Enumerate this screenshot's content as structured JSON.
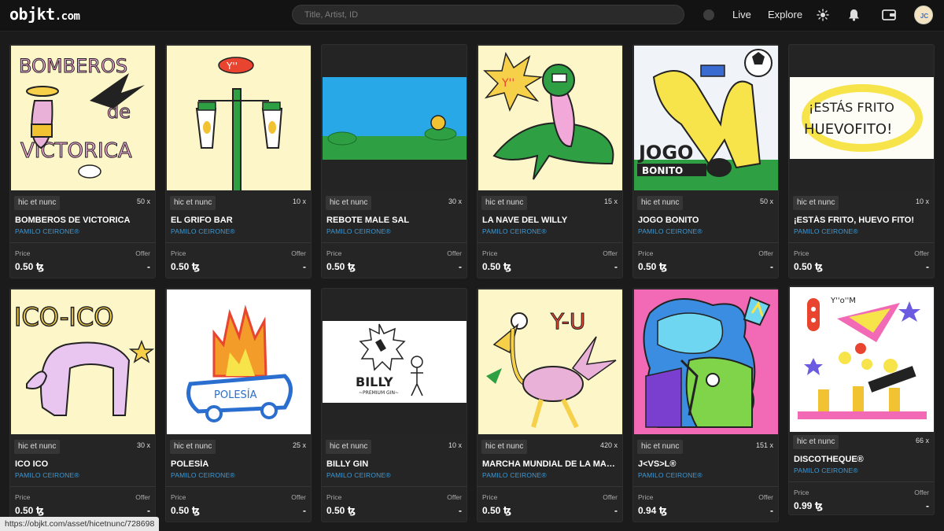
{
  "header": {
    "logo_main": "objkt",
    "logo_suffix": ".com",
    "search_placeholder": "Title, Artist, ID",
    "nav": [
      "Live",
      "Explore"
    ]
  },
  "colors": {
    "accent_artist": "#3d9ad6",
    "background": "#1b1b1b",
    "card": "#252525"
  },
  "icons": [
    "sun-icon",
    "bell-icon",
    "wallet-icon",
    "avatar"
  ],
  "price_label": "Price",
  "offer_label": "Offer",
  "cards": [
    {
      "platform": "hic et nunc",
      "editions": "50 x",
      "title": "BOMBEROS DE VICTORICA",
      "artist": "PAMILO CEIRONE®",
      "price": "0.50 ꜩ",
      "offer": "-"
    },
    {
      "platform": "hic et nunc",
      "editions": "10 x",
      "title": "EL GRIFO BAR",
      "artist": "PAMILO CEIRONE®",
      "price": "0.50 ꜩ",
      "offer": "-"
    },
    {
      "platform": "hic et nunc",
      "editions": "30 x",
      "title": "REBOTE MALE SAL",
      "artist": "PAMILO CEIRONE®",
      "price": "0.50 ꜩ",
      "offer": "-"
    },
    {
      "platform": "hic et nunc",
      "editions": "15 x",
      "title": "LA NAVE DEL WILLY",
      "artist": "PAMILO CEIRONE®",
      "price": "0.50 ꜩ",
      "offer": "-"
    },
    {
      "platform": "hic et nunc",
      "editions": "50 x",
      "title": "JOGO BONITO",
      "artist": "PAMILO CEIRONE®",
      "price": "0.50 ꜩ",
      "offer": "-"
    },
    {
      "platform": "hic et nunc",
      "editions": "10 x",
      "title": "¡ESTÁS FRITO, HUEVO FITO!",
      "artist": "PAMILO CEIRONE®",
      "price": "0.50 ꜩ",
      "offer": "-"
    },
    {
      "platform": "hic et nunc",
      "editions": "30 x",
      "title": "ICO ICO",
      "artist": "PAMILO CEIRONE®",
      "price": "0.50 ꜩ",
      "offer": "-"
    },
    {
      "platform": "hic et nunc",
      "editions": "25 x",
      "title": "POLESÍA",
      "artist": "PAMILO CEIRONE®",
      "price": "0.50 ꜩ",
      "offer": "-"
    },
    {
      "platform": "hic et nunc",
      "editions": "10 x",
      "title": "BILLY GIN",
      "artist": "PAMILO CEIRONE®",
      "price": "0.50 ꜩ",
      "offer": "-"
    },
    {
      "platform": "hic et nunc",
      "editions": "420 x",
      "title": "MARCHA MUNDIAL DE LA MAR…",
      "artist": "PAMILO CEIRONE®",
      "price": "0.50 ꜩ",
      "offer": "-"
    },
    {
      "platform": "hic et nunc",
      "editions": "151 x",
      "title": "J<VS>L®",
      "artist": "PAMILO CEIRONE®",
      "price": "0.94 ꜩ",
      "offer": "-"
    },
    {
      "platform": "hic et nunc",
      "editions": "66 x",
      "title": "DISCOTHEQUE®",
      "artist": "PAMILO CEIRONE®",
      "price": "0.99 ꜩ",
      "offer": "-"
    }
  ],
  "artwork_text": {
    "bomberos_1": "BOMBEROS",
    "bomberos_2": "de",
    "bomberos_3": "VICTORICA",
    "grifo_sign": "Y''",
    "nave_burst": "Y''",
    "jogo_1": "JOGO",
    "jogo_2": "BONITO",
    "frito_1": "¡ESTÁS FRITO",
    "frito_2": "HUEVOFITO!",
    "ico": "ICO-ICO",
    "polesia": "POLESÍA",
    "billy": "BILLY",
    "billy_sub": "~PREMIUM GIN~",
    "marcha": "Y-U",
    "disco": "Y''o''M"
  },
  "status_bar": "https://objkt.com/asset/hicetnunc/728698"
}
